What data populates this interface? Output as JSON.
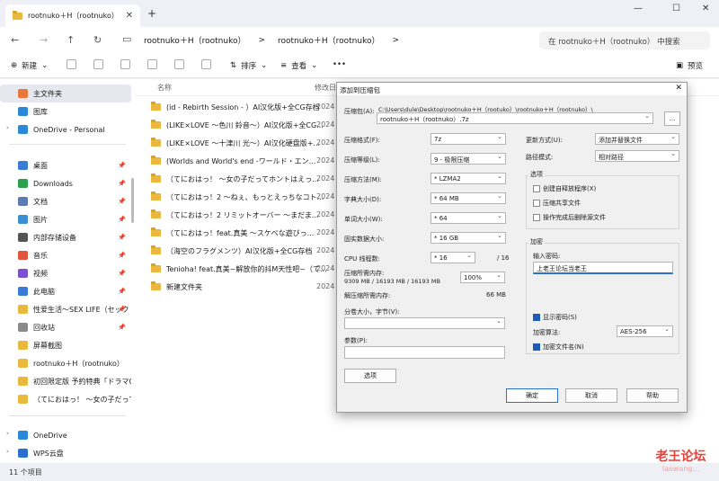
{
  "window": {
    "tab_title": "rootnuko＋H（rootnuko）",
    "new_tab": "+",
    "minimize": "—",
    "maximize": "☐",
    "close": "✕"
  },
  "address": {
    "crumbs": [
      "rootnuko＋H（rootnuko）",
      ">",
      "rootnuko＋H（rootnuko）",
      ">"
    ],
    "search_placeholder": "在 rootnuko＋H（rootnuko） 中搜索"
  },
  "toolbar": {
    "new_label": "新建",
    "sort_label": "排序",
    "view_label": "查看",
    "more_label": "•••",
    "preview_label": "预览"
  },
  "sidebar": {
    "items": [
      {
        "label": "主文件夹",
        "color": "#e8753a",
        "active": true
      },
      {
        "label": "图库",
        "color": "#2b88d8"
      },
      {
        "label": "OneDrive - Personal",
        "color": "#2b88d8"
      },
      {
        "label": "桌面",
        "color": "#3a7bd5",
        "pin": true
      },
      {
        "label": "Downloads",
        "color": "#2aa14b",
        "pin": true
      },
      {
        "label": "文档",
        "color": "#5b7bb4",
        "pin": true
      },
      {
        "label": "图片",
        "color": "#3b8fd4",
        "pin": true
      },
      {
        "label": "内部存储设备",
        "color": "#555555",
        "pin": true
      },
      {
        "label": "音乐",
        "color": "#e0533d",
        "pin": true
      },
      {
        "label": "视频",
        "color": "#7a4fd1",
        "pin": true
      },
      {
        "label": "此电脑",
        "color": "#3a7bd5",
        "pin": true
      },
      {
        "label": "性爱生活～SEX LIFE（セック",
        "color": "#e9b83c",
        "pin": true
      },
      {
        "label": "回收站",
        "color": "#8a8a8a",
        "pin": true
      },
      {
        "label": "屏幕截图",
        "color": "#e9b83c"
      },
      {
        "label": "rootnuko＋H（rootnuko）",
        "color": "#e9b83c"
      },
      {
        "label": "初回限定版 予約特典「ドラマCI",
        "color": "#e9b83c"
      },
      {
        "label": "（てにおはっ！ ～女の子だって",
        "color": "#e9b83c"
      },
      {
        "label": "OneDrive",
        "color": "#2b88d8"
      },
      {
        "label": "WPS云盘",
        "color": "#2b6fd3"
      }
    ]
  },
  "file_list": {
    "col_name": "名称",
    "col_date": "修改日",
    "rows": [
      {
        "name": "(id - Rebirth Session - ）AI汉化版+全CG存档",
        "date": "2024"
      },
      {
        "name": "(LIKE×LOVE ～色川 鈴音～）AI汉化版+全CG...",
        "date": "2024"
      },
      {
        "name": "(LIKE×LOVE ～十津川 光～）AI汉化硬盘版+...",
        "date": "2024"
      },
      {
        "name": "(Worlds and World's end -ワールド・エン...",
        "date": "2024"
      },
      {
        "name": "（てにおはっ！ ～女の子だってホントはえっ...",
        "date": "2024"
      },
      {
        "name": "（てにおはっ！2 ～ねぇ、もっとえっちなコト...",
        "date": "2024"
      },
      {
        "name": "（てにおはっ！2 リミットオーバー ～まだま...",
        "date": "2024"
      },
      {
        "name": "（てにおはっ！feat.真美 ～スケベな遊びっ...",
        "date": "2024"
      },
      {
        "name": "（海空のフラグメンツ）AI汉化版+全CG存档",
        "date": "2024"
      },
      {
        "name": "Tenioha! feat.真美~解放你的抖M天性吧~（て...",
        "date": "2024"
      },
      {
        "name": "新建文件夹",
        "date": "2024"
      }
    ]
  },
  "status": {
    "count": "11 个项目"
  },
  "watermark": {
    "main": "老王论坛",
    "sub": "laowang..."
  },
  "dialog": {
    "title": "添加到压缩包",
    "archive_label": "压缩包(A):",
    "archive_path": "C:\\Users\\dule\\Desktop\\rootnuko＋H（rootuko）\\rootnuko＋H（rootnuko）\\",
    "archive_name": "rootnuko＋H（rootnuko）.7z",
    "browse": "...",
    "format_label": "压缩格式(F):",
    "format_value": "7z",
    "level_label": "压缩等级(L):",
    "level_value": "9 - 极限压缩",
    "method_label": "压缩方法(M):",
    "method_value": "* LZMA2",
    "dict_label": "字典大小(D):",
    "dict_value": "* 64 MB",
    "word_label": "单词大小(W):",
    "word_value": "* 64",
    "solid_label": "固实数据大小:",
    "solid_value": "* 16 GB",
    "cpu_label": "CPU 线程数:",
    "cpu_value": "* 16",
    "cpu_total": "/ 16",
    "mem_label": "压缩所需内存:",
    "mem_value": "9309 MB / 16193 MB / 16193 MB",
    "mem_percent": "100%",
    "decomp_label": "解压缩所需内存:",
    "decomp_value": "66 MB",
    "split_label": "分卷大小，字节(V):",
    "params_label": "参数(P):",
    "options_btn": "选项",
    "update_label": "更新方式(U):",
    "update_value": "添加并替换文件",
    "pathmode_label": "路径模式:",
    "pathmode_value": "相对路径",
    "opts_title": "选项",
    "opt1": "创建自释放程序(X)",
    "opt2": "压缩共享文件",
    "opt3": "操作完成后删除源文件",
    "enc_title": "加密",
    "pwd_label": "输入密码:",
    "pwd_value": "上老王论坛当老王",
    "show_pwd": "显示密码(S)",
    "enc_method_label": "加密算法:",
    "enc_method_value": "AES-256",
    "enc_names": "加密文件名(N)",
    "ok": "确定",
    "cancel": "取消",
    "help": "帮助"
  }
}
